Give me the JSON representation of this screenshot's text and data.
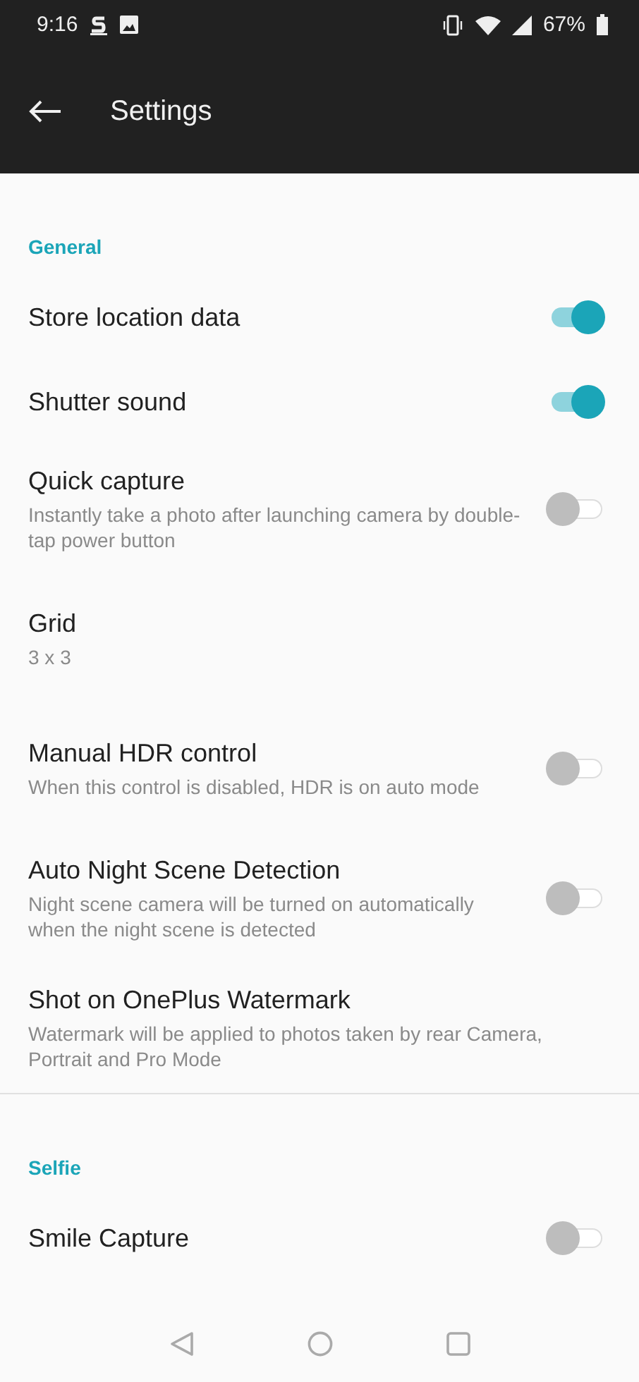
{
  "status_bar": {
    "time": "9:16",
    "battery": "67%"
  },
  "app_bar": {
    "title": "Settings"
  },
  "sections": [
    {
      "title": "General",
      "items": [
        {
          "kind": "toggle",
          "title": "Store location data",
          "on": true
        },
        {
          "kind": "toggle",
          "title": "Shutter sound",
          "on": true
        },
        {
          "kind": "toggle",
          "title": "Quick capture",
          "subtitle": "Instantly take a photo after launching camera by double-tap power button",
          "on": false
        },
        {
          "kind": "link",
          "title": "Grid",
          "subtitle": "3 x 3"
        },
        {
          "kind": "toggle",
          "title": "Manual HDR control",
          "subtitle": "When this control is disabled, HDR is on auto mode",
          "on": false
        },
        {
          "kind": "toggle",
          "title": "Auto Night Scene Detection",
          "subtitle": "Night scene camera will be turned on automatically when the night scene is detected",
          "on": false
        },
        {
          "kind": "link",
          "title": "Shot on OnePlus Watermark",
          "subtitle": "Watermark will be applied to photos taken by rear Camera, Portrait and Pro Mode"
        }
      ]
    },
    {
      "title": "Selfie",
      "items": [
        {
          "kind": "toggle",
          "title": "Smile Capture",
          "on": false
        }
      ]
    }
  ]
}
